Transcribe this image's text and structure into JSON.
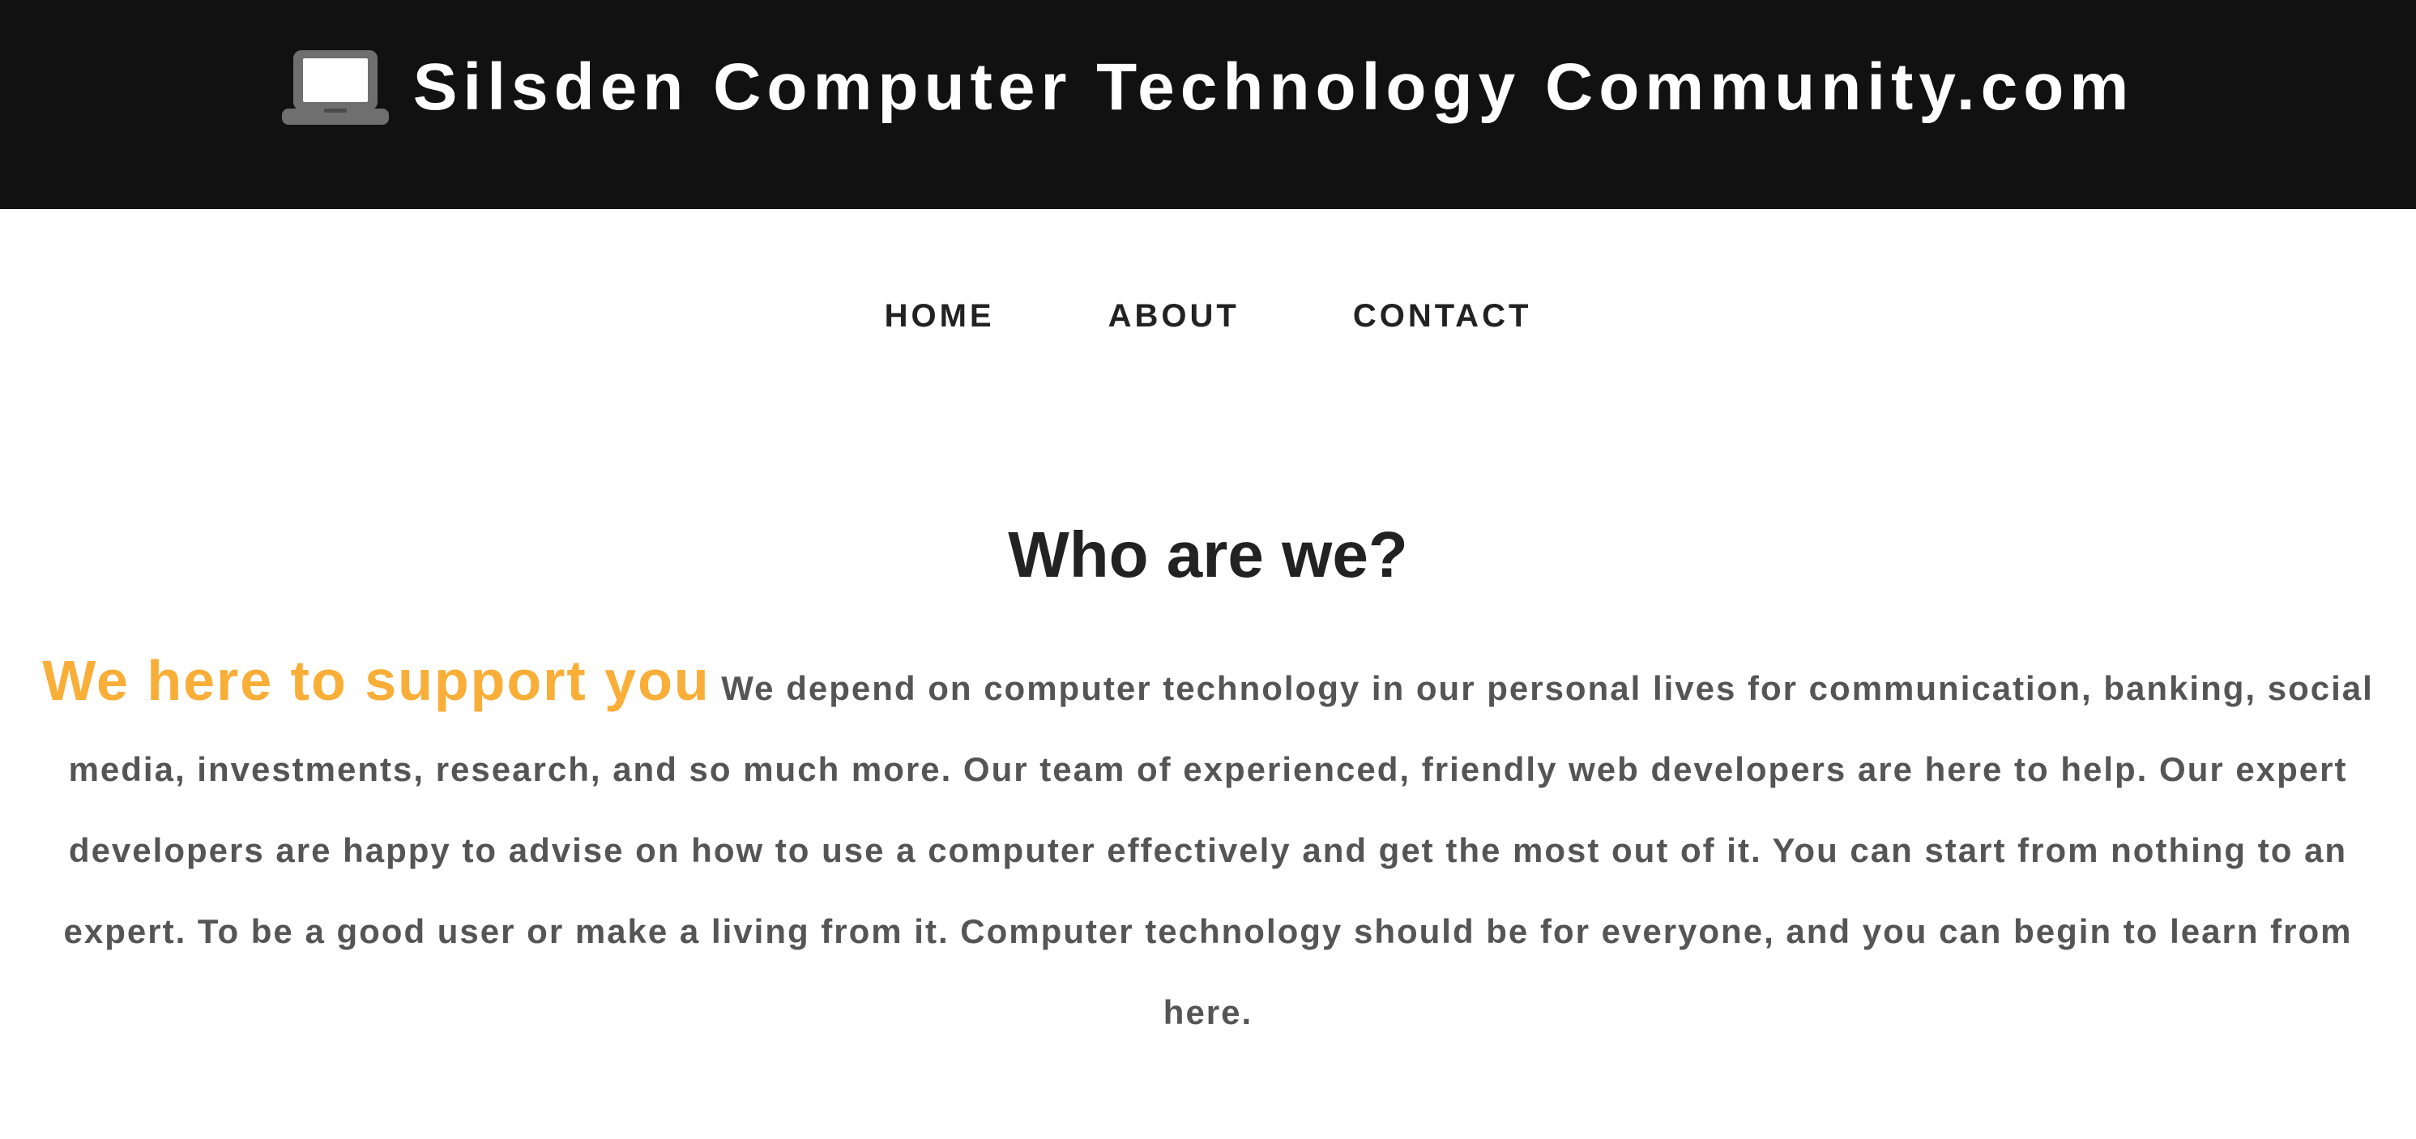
{
  "header": {
    "icon": "laptop-icon",
    "title": "Silsden Computer Technology Community.com",
    "background_color": "#111111"
  },
  "nav": {
    "items": [
      {
        "label": "HOME"
      },
      {
        "label": "ABOUT"
      },
      {
        "label": "CONTACT"
      }
    ]
  },
  "about": {
    "heading": "Who are we?",
    "highlight": "We here to support you",
    "highlight_color": "#f9ae38",
    "body": "We depend on computer technology in our personal lives for communication, banking, social media, investments, research, and so much more. Our team of experienced, friendly web developers are here to help. Our expert developers are happy to advise on how to use a computer effectively and get the most out of it. You can start from nothing to an expert. To be a good user or make a living from it. Computer technology should be for everyone, and you can begin to learn from here."
  }
}
